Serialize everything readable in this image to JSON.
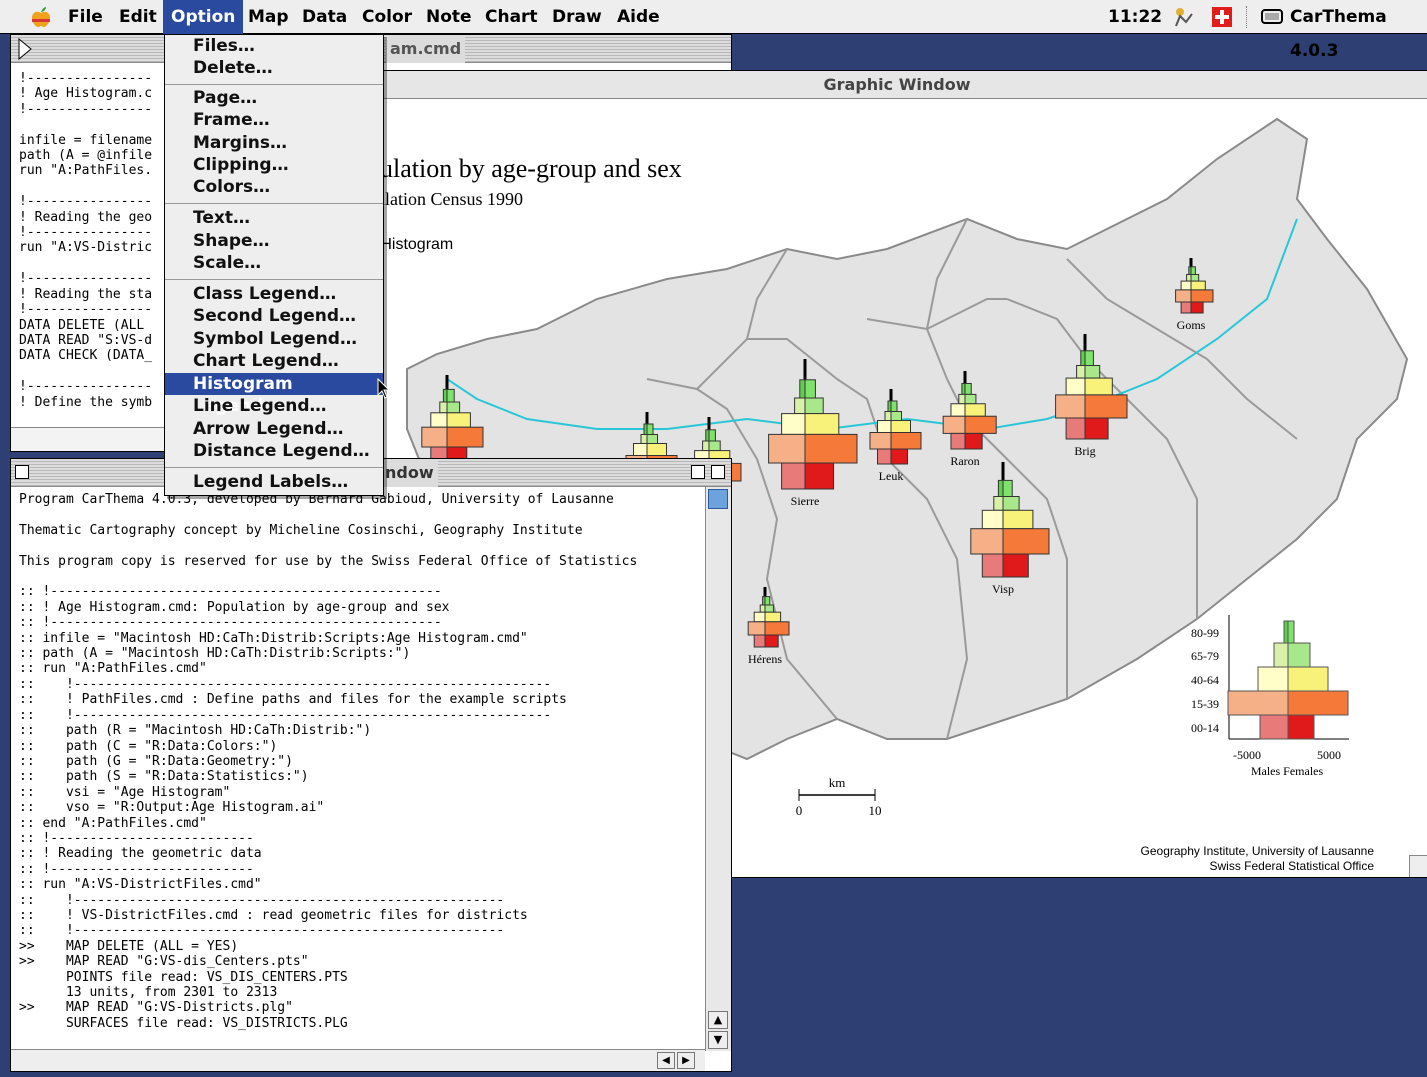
{
  "menubar": {
    "items": [
      "File",
      "Edit",
      "Option",
      "Map",
      "Data",
      "Color",
      "Note",
      "Chart",
      "Draw",
      "Aide"
    ],
    "active": "Option",
    "clock": "11:22",
    "app_name": "CarThema 4.0.3"
  },
  "option_menu": {
    "items": [
      "Files…",
      "Delete…",
      "Page…",
      "Frame…",
      "Margins…",
      "Clipping…",
      "Colors…",
      "Text…",
      "Shape…",
      "Scale…",
      "Class Legend…",
      "Second Legend…",
      "Symbol Legend…",
      "Chart Legend…",
      "Histogram Legend…",
      "Line Legend…",
      "Arrow Legend…",
      "Distance Legend…",
      "Legend Labels…"
    ],
    "highlighted": "Histogram Legend…"
  },
  "script_window": {
    "title_fragment": "am.cmd",
    "lines": [
      "!----------------",
      "! Age Histogram.c",
      "!----------------",
      "",
      "infile = filename",
      "path (A = @infile",
      "run \"A:PathFiles.",
      "",
      "!----------------",
      "! Reading the geo",
      "!----------------",
      "run \"A:VS-Distric",
      "",
      "!----------------",
      "! Reading the sta",
      "!----------------",
      "DATA DELETE (ALL",
      "DATA READ \"S:VS-d",
      "DATA CHECK (DATA_",
      "",
      "!----------------",
      "! Define the symb"
    ]
  },
  "graphic_window": {
    "title": "Graphic Window",
    "map_title": "pulation by age-group and sex",
    "subtitle": "pulation Census 1990",
    "tag": "e Histogram",
    "districts": [
      "Goms",
      "Brig",
      "Raron",
      "Leuk",
      "Sierre",
      "Visp",
      "Hérens"
    ],
    "scale": {
      "label": "km",
      "start": "0",
      "end": "10"
    },
    "legend": {
      "classes": [
        "80-99",
        "65-79",
        "40-64",
        "15-39",
        "00-14"
      ],
      "axis": [
        "-5000",
        "5000"
      ],
      "sides": "Males  Females"
    },
    "credits": [
      "Geography Institute, University of Lausanne",
      "Swiss Federal Statistical Office"
    ]
  },
  "log_window": {
    "title_fragment": "ndow",
    "lines": [
      "Program CarThema 4.0.3, developed by Bernard Gabioud, University of Lausanne",
      "",
      "Thematic Cartography concept by Micheline Cosinschi, Geography Institute",
      "",
      "This program copy is reserved for use by the Swiss Federal Office of Statistics",
      "",
      ":: !--------------------------------------------------",
      ":: ! Age Histogram.cmd: Population by age-group and sex",
      ":: !--------------------------------------------------",
      ":: infile = \"Macintosh HD:CaTh:Distrib:Scripts:Age Histogram.cmd\"",
      ":: path (A = \"Macintosh HD:CaTh:Distrib:Scripts:\")",
      ":: run \"A:PathFiles.cmd\"",
      "::    !-------------------------------------------------------------",
      "::    ! PathFiles.cmd : Define paths and files for the example scripts",
      "::    !-------------------------------------------------------------",
      "::    path (R = \"Macintosh HD:CaTh:Distrib:\")",
      "::    path (C = \"R:Data:Colors:\")",
      "::    path (G = \"R:Data:Geometry:\")",
      "::    path (S = \"R:Data:Statistics:\")",
      "::    vsi = \"Age Histogram\"",
      "::    vso = \"R:Output:Age Histogram.ai\"",
      ":: end \"A:PathFiles.cmd\"",
      ":: !--------------------------",
      ":: ! Reading the geometric data",
      ":: !--------------------------",
      ":: run \"A:VS-DistrictFiles.cmd\"",
      "::    !-------------------------------------------------------",
      "::    ! VS-DistrictFiles.cmd : read geometric files for districts",
      "::    !-------------------------------------------------------",
      ">>    MAP DELETE (ALL = YES)",
      ">>    MAP READ \"G:VS-dis_Centers.pts\"",
      "      POINTS file read: VS_DIS_CENTERS.PTS",
      "      13 units, from 2301 to 2313",
      ">>    MAP READ \"G:VS-Districts.plg\"",
      "      SURFACES file read: VS_DISTRICTS.PLG"
    ]
  },
  "colors": {
    "desktop": "#2d3f73",
    "highlight": "#2a4aa0",
    "map_fill": "#e3e3e3",
    "river": "#29c6d8"
  }
}
